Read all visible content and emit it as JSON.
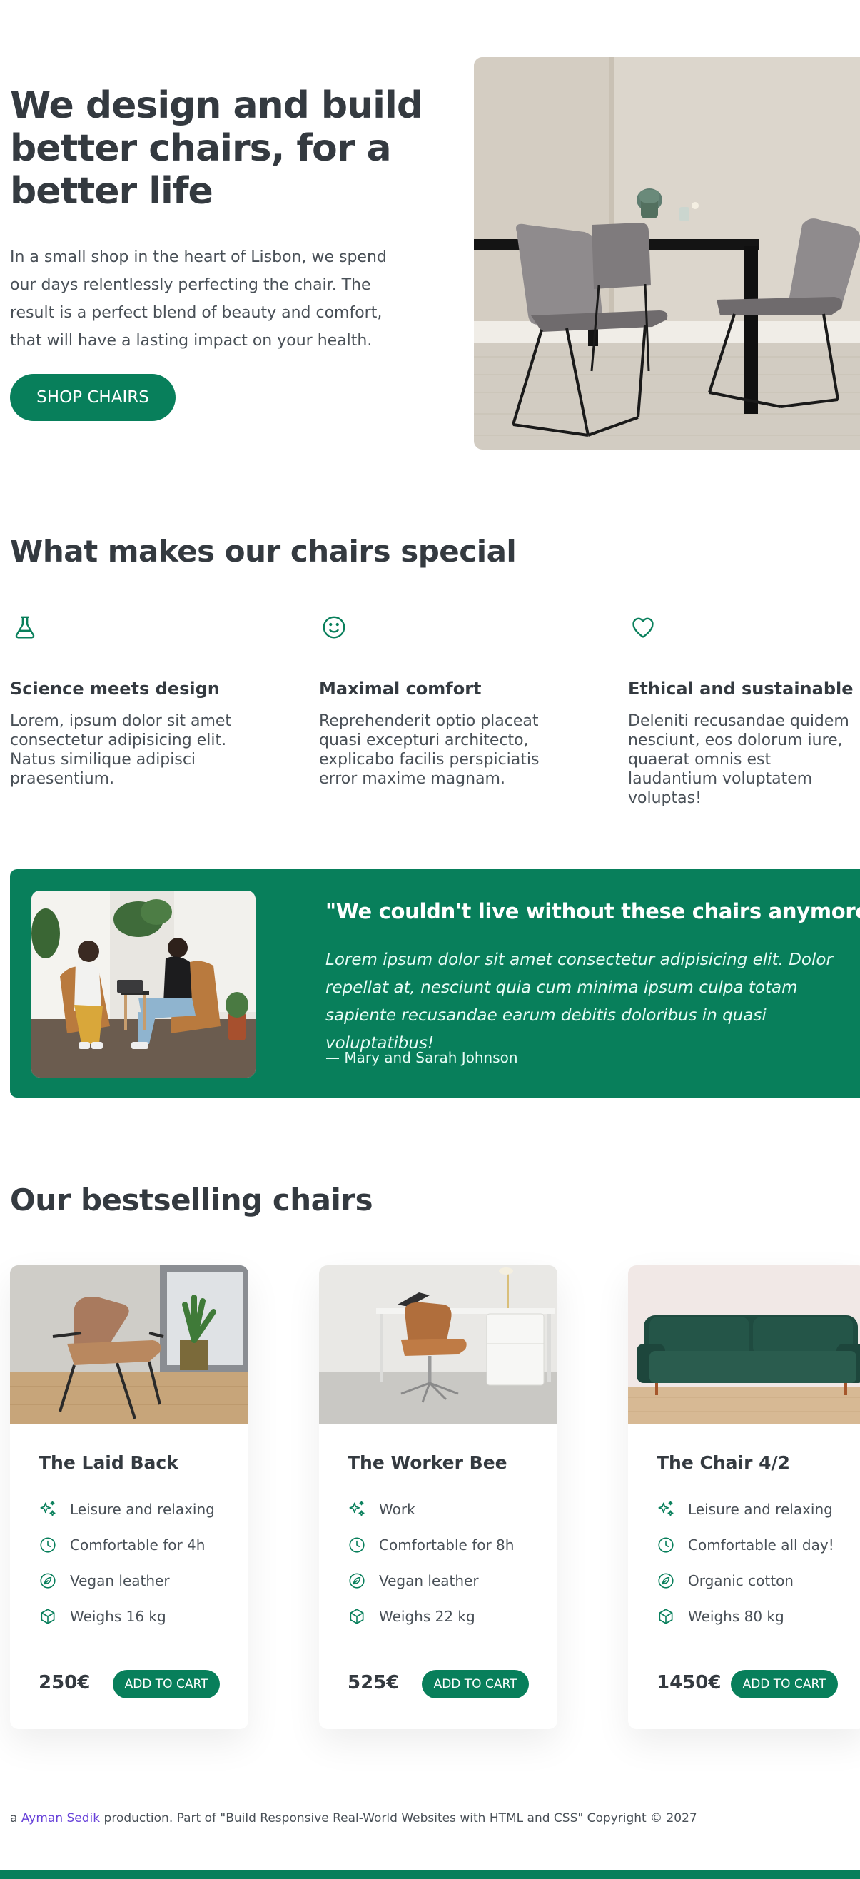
{
  "hero": {
    "title": "We design and build better chairs, for a better life",
    "text": "In a small shop in the heart of Lisbon, we spend our days relentlessly perfecting the chair. The result is a perfect blend of beauty and comfort, that will have a lasting impact on your health.",
    "button": "SHOP CHAIRS"
  },
  "special": {
    "heading": "What makes our chairs special",
    "features": [
      {
        "icon": "flask-icon",
        "title": "Science meets design",
        "text": "Lorem, ipsum dolor sit amet consectetur adipisicing elit. Natus similique adipisci praesentium."
      },
      {
        "icon": "smiley-icon",
        "title": "Maximal comfort",
        "text": "Reprehenderit optio placeat quasi excepturi architecto, explicabo facilis perspiciatis error maxime magnam."
      },
      {
        "icon": "heart-icon",
        "title": "Ethical and sustainable",
        "text": "Deleniti recusandae quidem nesciunt, eos dolorum iure, quaerat omnis est laudantium voluptatem voluptas!"
      }
    ]
  },
  "testimonial": {
    "quote_title": "\"We couldn't live without these chairs anymore\"",
    "text": "Lorem ipsum dolor sit amet consectetur adipisicing elit. Dolor repellat at, nesciunt quia cum minima ipsum culpa totam sapiente recusandae earum debitis doloribus in quasi voluptatibus!",
    "author": "— Mary and Sarah Johnson"
  },
  "products": {
    "heading": "Our bestselling chairs",
    "cart_label": "ADD TO CART",
    "items": [
      {
        "name": "The Laid Back",
        "price": "250€",
        "attributes": [
          "Leisure and relaxing",
          "Comfortable for 4h",
          "Vegan leather",
          "Weighs 16 kg"
        ]
      },
      {
        "name": "The Worker Bee",
        "price": "525€",
        "attributes": [
          "Work",
          "Comfortable for 8h",
          "Vegan leather",
          "Weighs 22 kg"
        ]
      },
      {
        "name": "The Chair 4/2",
        "price": "1450€",
        "attributes": [
          "Leisure and relaxing",
          "Comfortable all day!",
          "Organic cotton",
          "Weighs 80 kg"
        ]
      }
    ]
  },
  "footer": {
    "prefix": "a ",
    "author_link": "Ayman Sedik",
    "suffix": " production. Part of \"Build Responsive Real-World Websites with HTML and CSS\" Copyright © 2027"
  },
  "colors": {
    "primary": "#087f5b",
    "text": "#343a40",
    "link": "#6741d9"
  },
  "attribute_icons": [
    "sparkles-icon",
    "clock-icon",
    "leaf-icon",
    "box-icon"
  ]
}
